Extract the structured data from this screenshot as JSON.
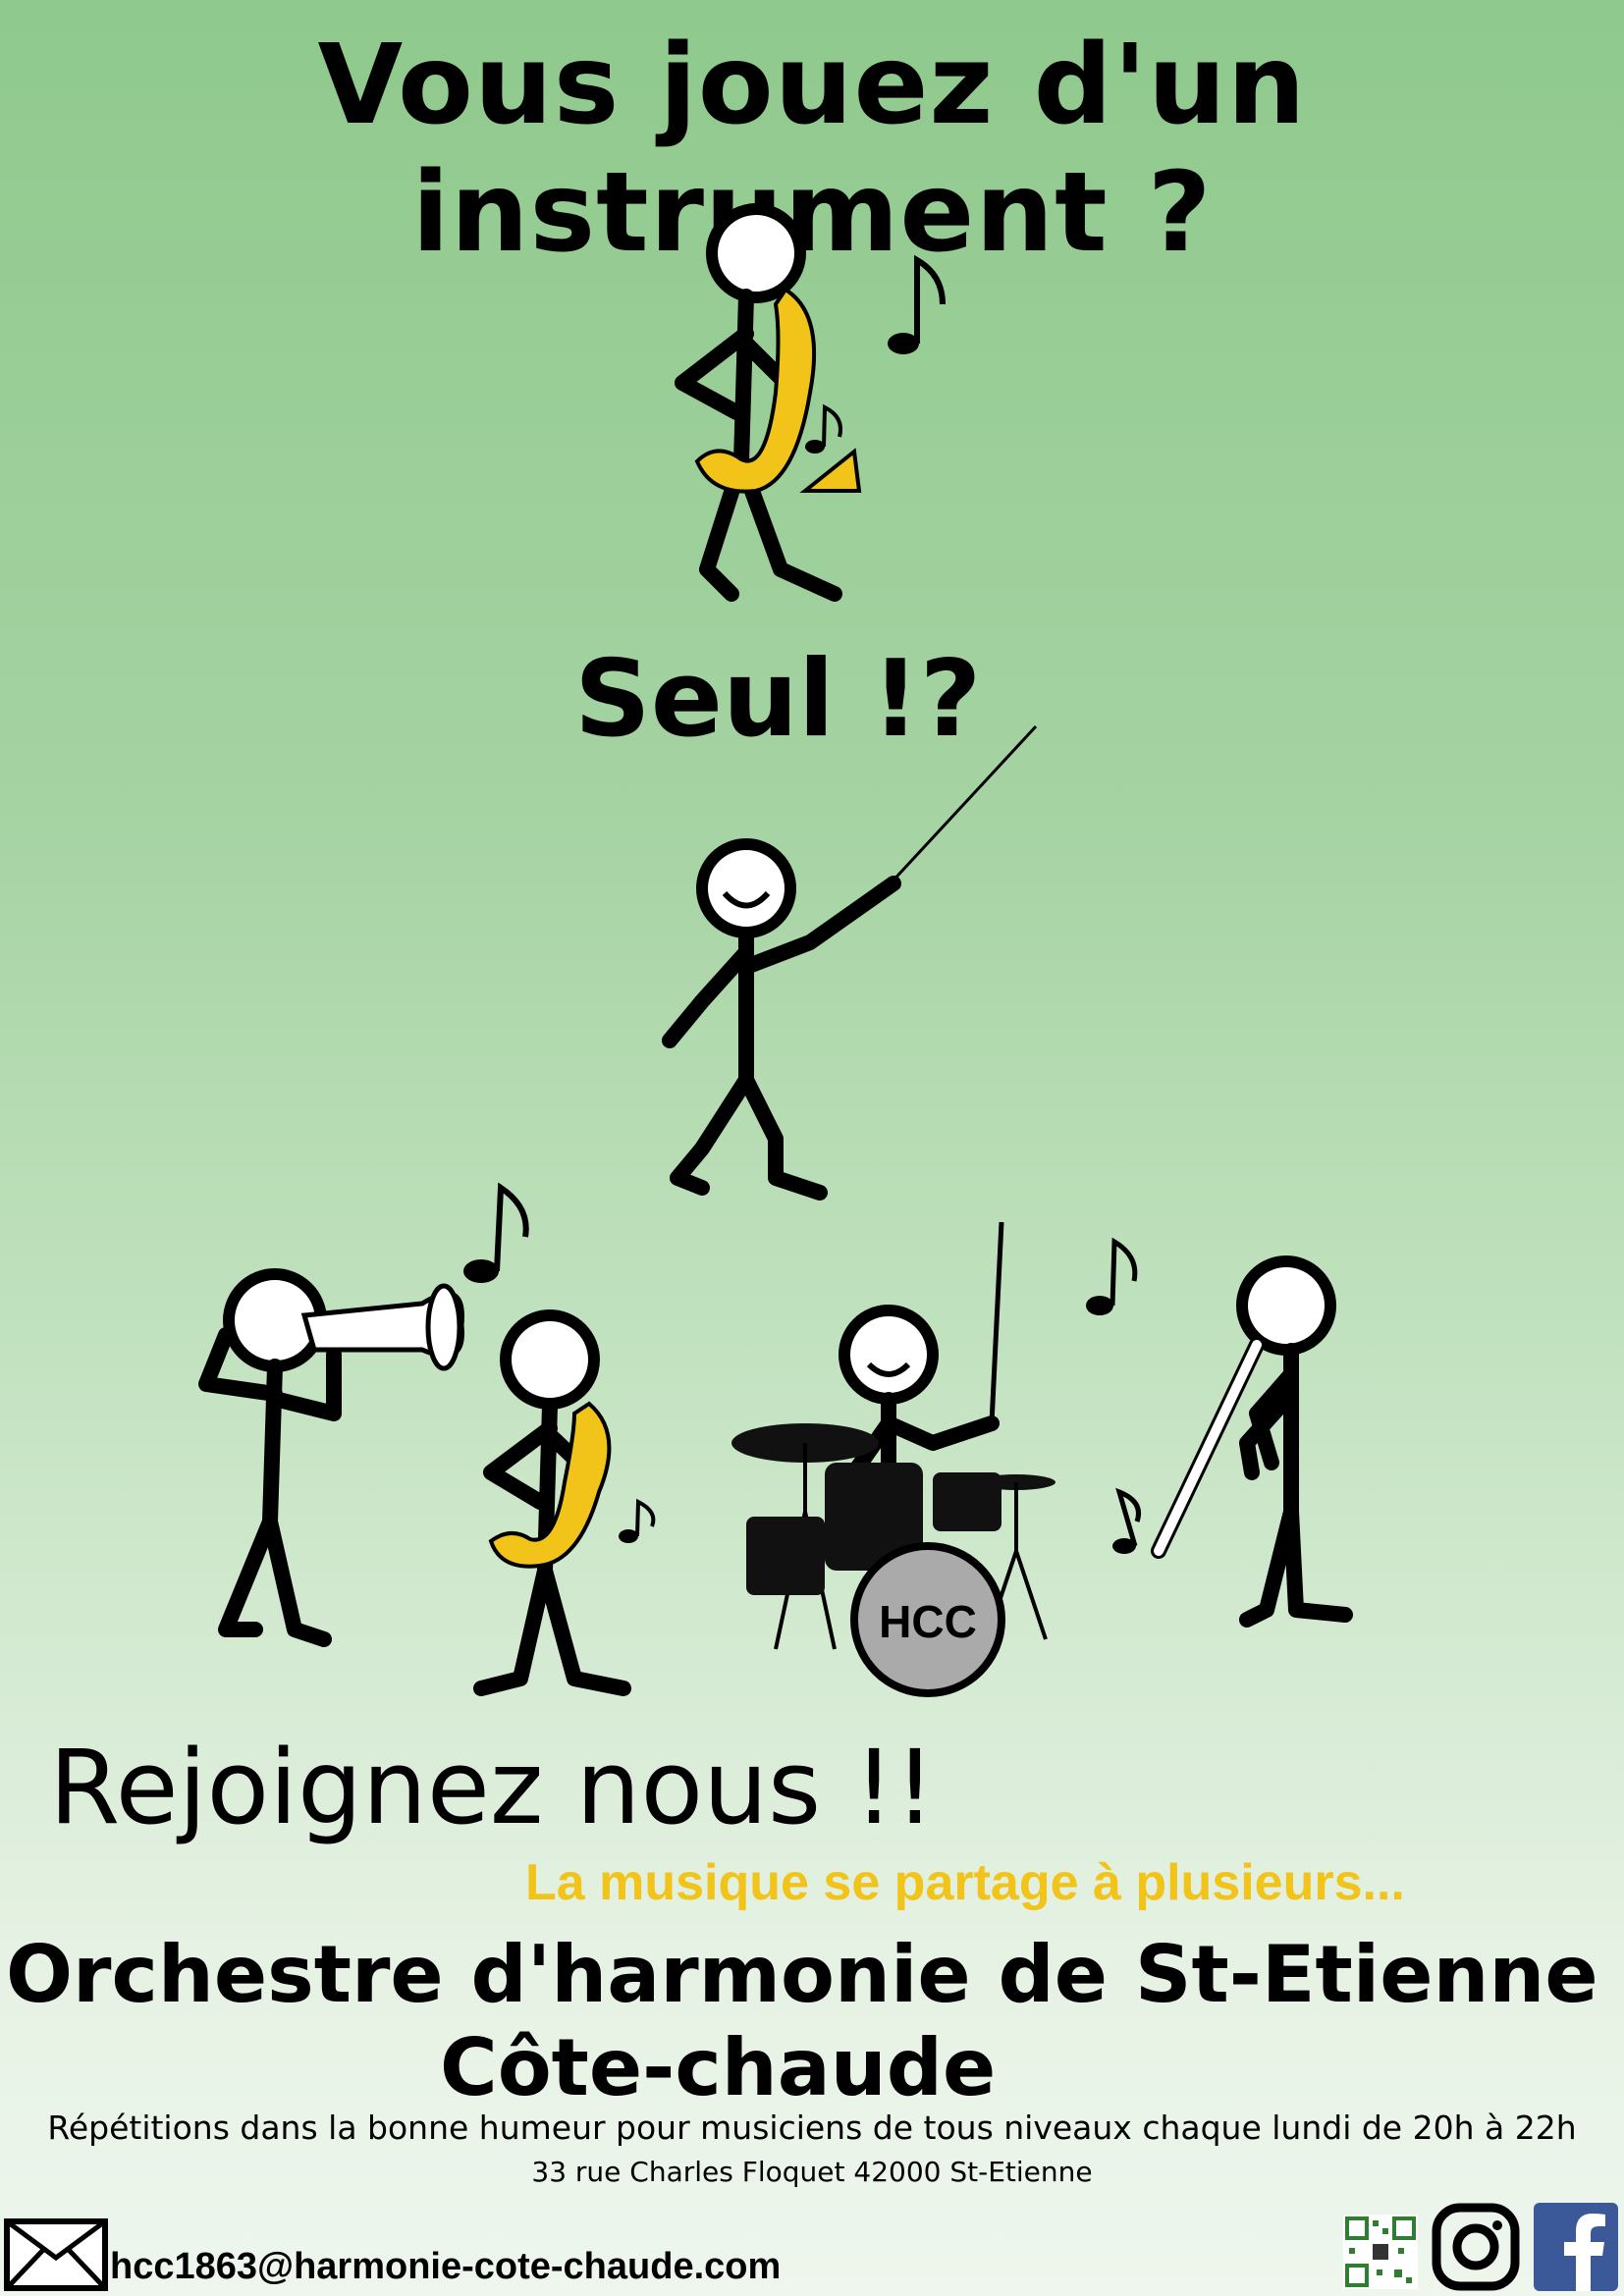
{
  "poster": {
    "headline": "Vous jouez d'un instrument ?",
    "seul": "Seul !?",
    "join": "Rejoignez nous !!",
    "tagline": "La musique se partage à plusieurs...",
    "org_line1": "Orchestre d'harmonie de St-Etienne",
    "org_line2": "Côte-chaude",
    "rehearsals": "Répétitions dans la bonne humeur pour musiciens de tous niveaux chaque lundi de 20h à 22h",
    "address": "33 rue Charles Floquet 42000 St-Etienne",
    "drum_logo": "HCC"
  },
  "contact": {
    "email": "hcc1863@harmonie-cote-chaude.com",
    "icons": [
      "envelope-icon",
      "qr-code-icon",
      "instagram-icon",
      "facebook-icon"
    ]
  },
  "colors": {
    "background_top": "#8fc98d",
    "background_bottom": "#eef6ed",
    "tagline": "#f2c318",
    "saxophone": "#f2c318",
    "facebook": "#3b5998"
  }
}
